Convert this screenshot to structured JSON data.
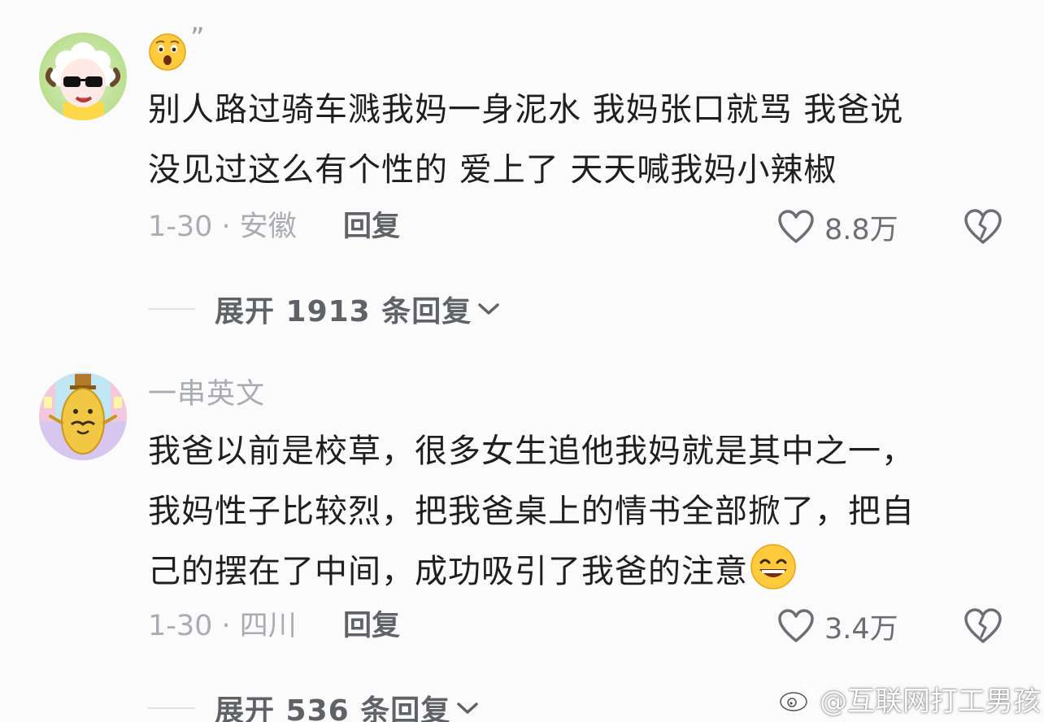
{
  "comments": [
    {
      "username": "",
      "avatar": "sheep-with-sunglasses-avatar",
      "lead_emoji": "astonished-face-emoji",
      "lead_quote": "”",
      "text_lines": [
        "别人路过骑车溅我妈一身泥水 我妈张口就骂  我爸说",
        "没见过这么有个性的 爱上了 天天喊我妈小辣椒"
      ],
      "date_location": "1-30 · 安徽",
      "reply_label": "回复",
      "like_count": "8.8万",
      "expand_label": "展开 1913 条回复"
    },
    {
      "username": "一串英文",
      "avatar": "cartoon-potato-avatar",
      "text_lines": [
        "我爸以前是校草，很多女生追他我妈就是其中之一，",
        "我妈性子比较烈，把我爸桌上的情书全部掀了，把自",
        "己的摆在了中间，成功吸引了我爸的注意"
      ],
      "trailing_emoji": "grinning-face-emoji",
      "date_location": "1-30 · 四川",
      "reply_label": "回复",
      "like_count": "3.4万",
      "expand_label": "展开 536 条回复"
    }
  ],
  "watermark": "@互联网打工男孩",
  "colors": {
    "background": "#fbfbfb",
    "text_primary": "#1f1f22",
    "text_secondary": "#a9adb3",
    "action_gray": "#5f6368"
  }
}
